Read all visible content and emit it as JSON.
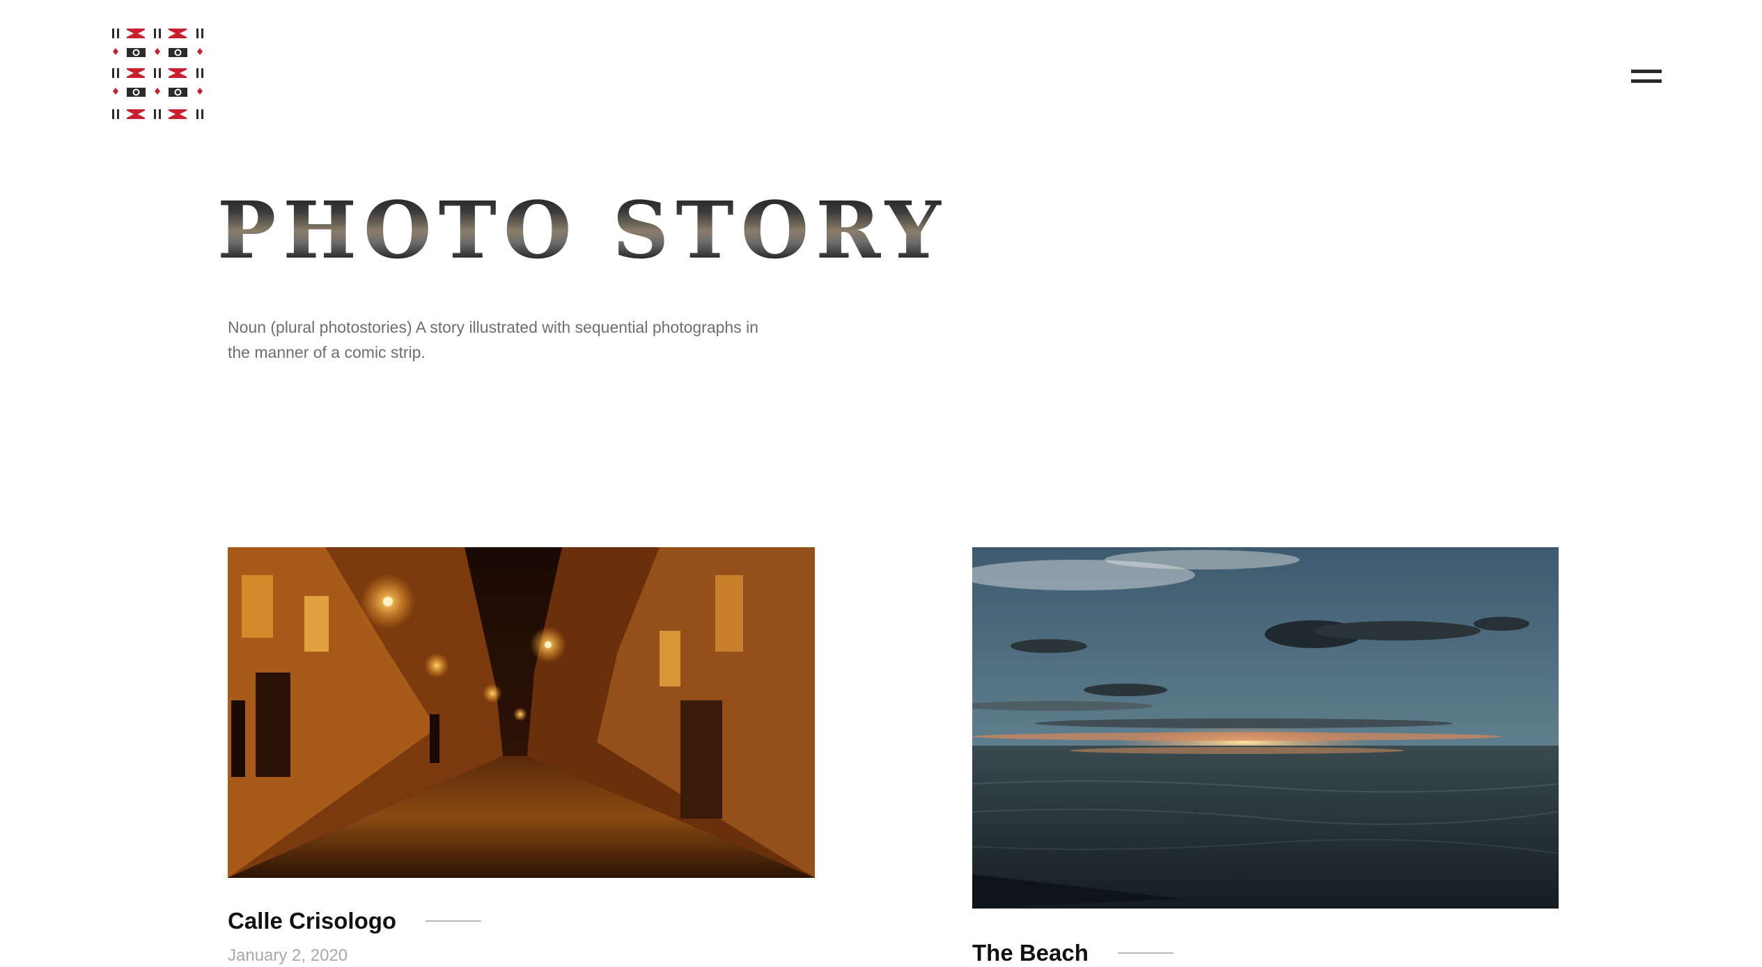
{
  "header": {
    "logo_icon": "pattern-logo-icon",
    "menu_icon": "hamburger-menu-icon"
  },
  "hero": {
    "title": "PHOTO STORY",
    "description": "Noun (plural photostories) A story illustrated with sequential photographs in the manner of a comic strip."
  },
  "posts": [
    {
      "title": "Calle Crisologo",
      "date": "January 2, 2020",
      "image_icon": "street-night-photo"
    },
    {
      "title": "The Beach",
      "image_icon": "sunset-beach-photo"
    }
  ],
  "colors": {
    "accent_red": "#c8202f",
    "dark": "#2b2b2b",
    "muted_text": "#6e6e6e",
    "date_text": "#a8a8a8",
    "rule": "#b9b9b9"
  }
}
